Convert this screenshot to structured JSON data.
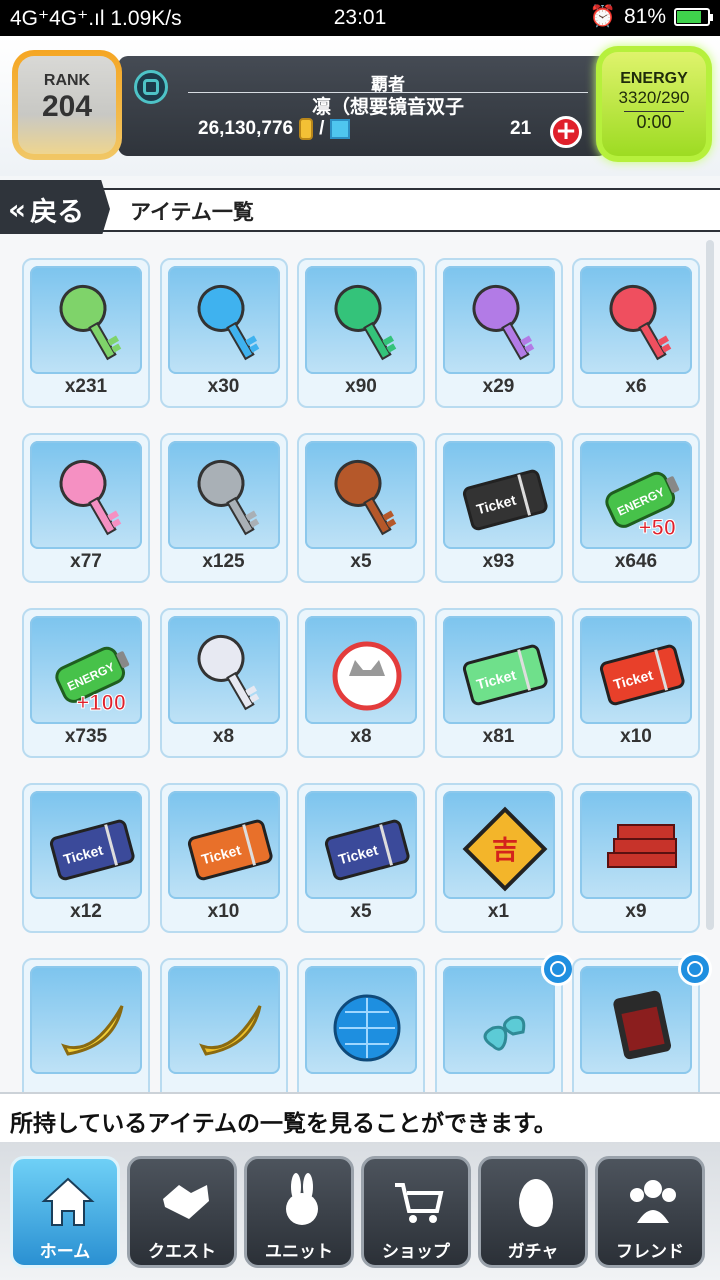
{
  "status_bar": {
    "network": "4G⁺4G⁺.ıl",
    "speed": "1.09K/s",
    "time": "23:01",
    "battery": "81%",
    "battery_level": 0.81
  },
  "header": {
    "rank_label": "RANK",
    "rank_value": "204",
    "title": "覇者",
    "player_name": "凛（想要镜音双子",
    "money": "26,130,776",
    "separator": "/",
    "gems": "21",
    "plus": "+",
    "energy_label": "ENERGY",
    "energy_value": "3320/290",
    "energy_timer": "0:00"
  },
  "nav": {
    "back_label": "戻る",
    "back_chevron": "«",
    "title": "アイテム一覧"
  },
  "items": [
    {
      "count": "x231",
      "icon": "rainbow-bunny-key",
      "color": "#7fd36a"
    },
    {
      "count": "x30",
      "icon": "blue-devil-key",
      "color": "#3fb2ef"
    },
    {
      "count": "x90",
      "icon": "green-key",
      "color": "#34c37a"
    },
    {
      "count": "x29",
      "icon": "purple-devil-key",
      "color": "#b27be6"
    },
    {
      "count": "x6",
      "icon": "red-winged-key",
      "color": "#ef4f5f"
    },
    {
      "count": "x77",
      "icon": "pink-star-key",
      "color": "#f590c2"
    },
    {
      "count": "x125",
      "icon": "silver-key",
      "color": "#a9b0b6"
    },
    {
      "count": "x5",
      "icon": "bronze-arrow-key",
      "color": "#b5582a"
    },
    {
      "count": "x93",
      "icon": "ticket",
      "color": "#333333"
    },
    {
      "count": "x646",
      "icon": "energy-battery",
      "color": "#47c24a",
      "badge": "+50"
    },
    {
      "count": "x735",
      "icon": "energy-battery",
      "color": "#47c24a",
      "badge": "+100"
    },
    {
      "count": "x8",
      "icon": "cat-key",
      "color": "#e7e9f2"
    },
    {
      "count": "x8",
      "icon": "cat-medal",
      "color": "#e33c3c"
    },
    {
      "count": "x81",
      "icon": "crown-ticket",
      "color": "#6fe08b"
    },
    {
      "count": "x10",
      "icon": "gold-ticket",
      "color": "#e8402a"
    },
    {
      "count": "x12",
      "icon": "rainbow-ticket",
      "color": "#3b4a9a"
    },
    {
      "count": "x10",
      "icon": "super-ticket",
      "color": "#e8702a"
    },
    {
      "count": "x5",
      "icon": "rainbow-ticket",
      "color": "#3b4a9a"
    },
    {
      "count": "x1",
      "icon": "lucky-card",
      "color": "#f3b52a"
    },
    {
      "count": "x9",
      "icon": "iron-bars",
      "color": "#c7332a"
    },
    {
      "count": "",
      "icon": "banana",
      "color": "#f4d23a"
    },
    {
      "count": "",
      "icon": "golden-bananas",
      "color": "#f0c22a"
    },
    {
      "count": "",
      "icon": "disco-ball",
      "color": "#1e8fe0"
    },
    {
      "count": "",
      "icon": "music-note",
      "color": "#5ccbd6",
      "timed": true
    },
    {
      "count": "",
      "icon": "sd-card",
      "color": "#8b1e1e",
      "timed": true
    }
  ],
  "info_text": "所持しているアイテムの一覧を見ることができます。",
  "tabs": [
    {
      "label": "ホーム",
      "icon": "home-icon"
    },
    {
      "label": "クエスト",
      "icon": "handshake-icon"
    },
    {
      "label": "ユニット",
      "icon": "bunny-icon"
    },
    {
      "label": "ショップ",
      "icon": "cart-icon"
    },
    {
      "label": "ガチャ",
      "icon": "egg-icon"
    },
    {
      "label": "フレンド",
      "icon": "friends-icon"
    }
  ]
}
